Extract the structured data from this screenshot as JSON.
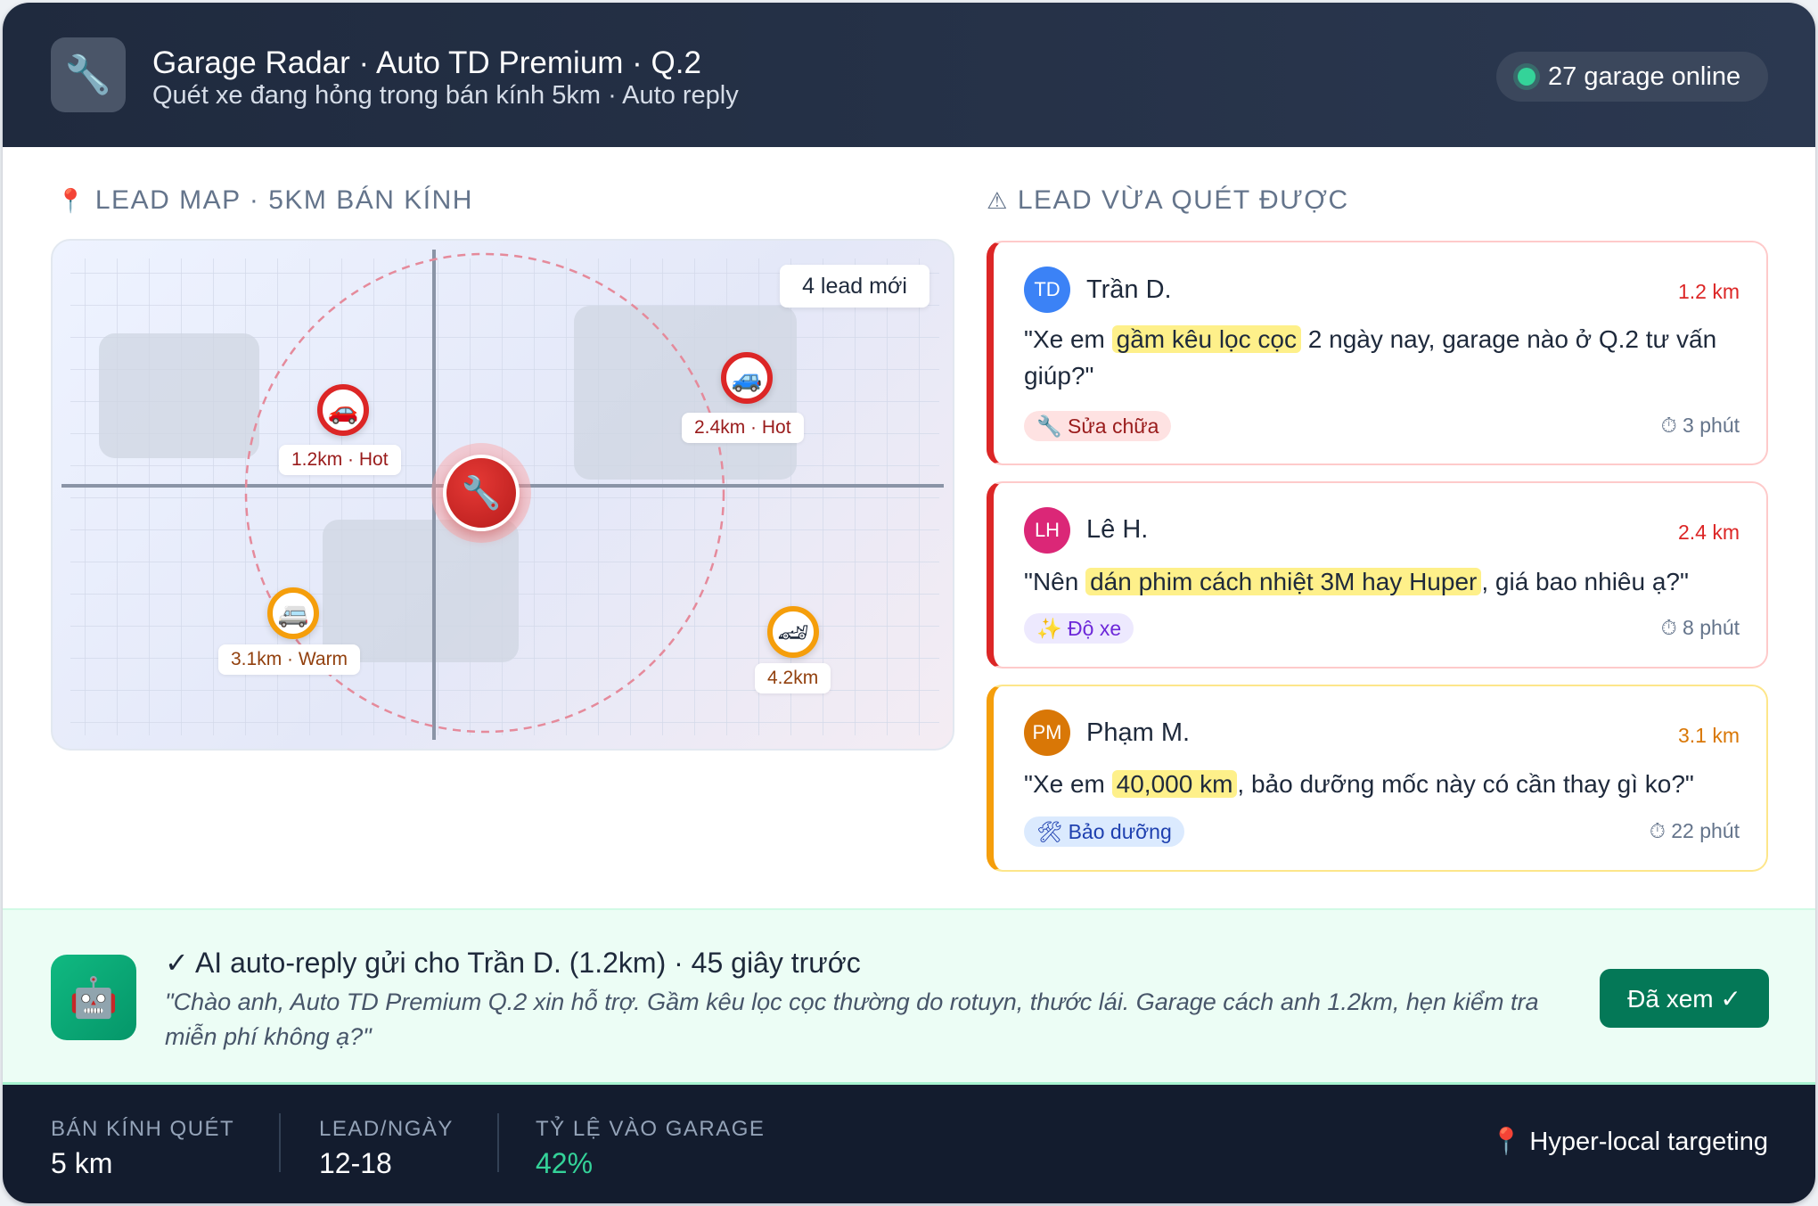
{
  "header": {
    "logo_icon": "wrench-icon",
    "title": "Garage Radar · Auto TD Premium · Q.2",
    "subtitle": "Quét xe đang hỏng trong bán kính 5km · Auto reply",
    "online_status": "27 garage online",
    "online_color": "#34d399"
  },
  "map_section": {
    "icon": "📍",
    "title": "LEAD MAP · 5KM BÁN KÍNH",
    "new_badge": "4 lead mới",
    "center_icon": "🔧",
    "pins": [
      {
        "icon": "🚗",
        "label": "1.2km · Hot",
        "level": "hot"
      },
      {
        "icon": "🚙",
        "label": "2.4km · Hot",
        "level": "hot"
      },
      {
        "icon": "🚐",
        "label": "3.1km · Warm",
        "level": "warm"
      },
      {
        "icon": "🏎",
        "label": "4.2km",
        "level": "warm"
      }
    ]
  },
  "leads_section": {
    "icon": "⚠",
    "title": "LEAD VỪA QUÉT ĐƯỢC",
    "leads": [
      {
        "initials": "TD",
        "name": "Trần D.",
        "distance": "1.2 km",
        "msg_before": "\"Xe em ",
        "msg_highlight": "gầm kêu lọc cọc",
        "msg_after": " 2 ngày nay, garage nào ở Q.2 tư vấn giúp?\"",
        "tag": "🔧 Sửa chữa",
        "time": "⏱ 3 phút",
        "avatar_color": "#3b82f6"
      },
      {
        "initials": "LH",
        "name": "Lê H.",
        "distance": "2.4 km",
        "msg_before": "\"Nên ",
        "msg_highlight": "dán phim cách nhiệt 3M hay Huper",
        "msg_after": ", giá bao nhiêu ạ?\"",
        "tag": "✨ Độ xe",
        "time": "⏱ 8 phút",
        "avatar_color": "#db2777"
      },
      {
        "initials": "PM",
        "name": "Phạm M.",
        "distance": "3.1 km",
        "msg_before": "\"Xe em ",
        "msg_highlight": "40,000 km",
        "msg_after": ", bảo dưỡng mốc này có cần thay gì ko?\"",
        "tag": "🛠 Bảo dưỡng",
        "time": "⏱ 22 phút",
        "avatar_color": "#d97706"
      }
    ]
  },
  "auto_reply": {
    "icon": "🤖",
    "title": "✓ AI auto-reply gửi cho Trần D. (1.2km) · 45 giây trước",
    "message": "\"Chào anh, Auto TD Premium Q.2 xin hỗ trợ. Gầm kêu lọc cọc thường do rotuyn, thước lái. Garage cách anh 1.2km, hẹn kiểm tra miễn phí không ạ?\"",
    "button": "Đã xem ✓"
  },
  "footer": {
    "stats": [
      {
        "label": "BÁN KÍNH QUÉT",
        "value": "5 km"
      },
      {
        "label": "LEAD/NGÀY",
        "value": "12-18"
      },
      {
        "label": "TỶ LỆ VÀO GARAGE",
        "value": "42%"
      }
    ],
    "right_icon": "📍",
    "right_text": "Hyper-local targeting"
  }
}
